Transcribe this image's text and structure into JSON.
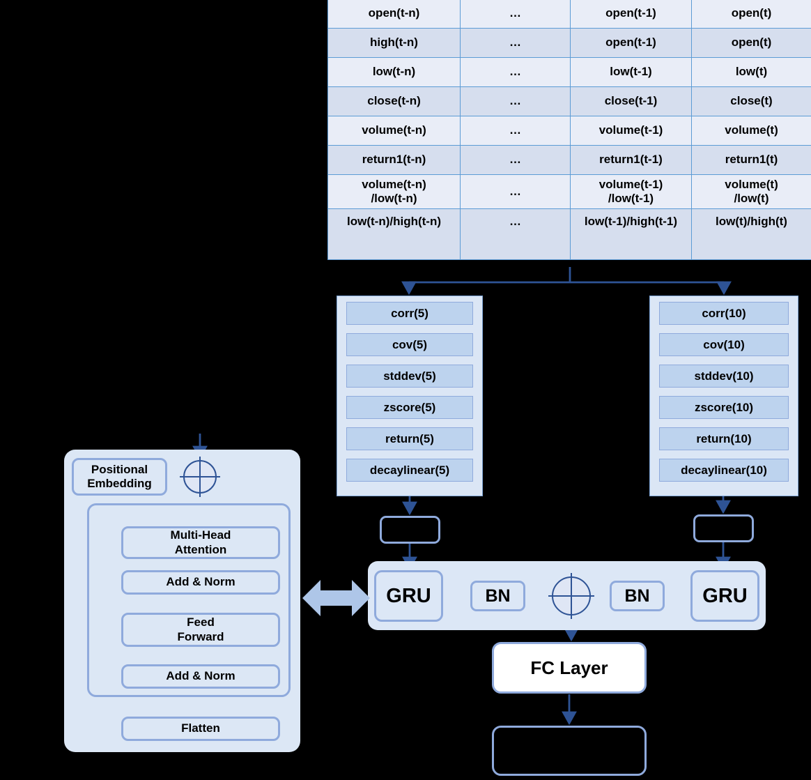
{
  "diagram": {
    "title": "Transformer-GRU factor model architecture",
    "colors": {
      "table_border": "#5b9bd5",
      "table_row_light": "#e9edf7",
      "table_row_dark": "#d6deee",
      "panel_fill": "#dce7f5",
      "box_fill": "#bdd3ee",
      "box_border": "#8faadc",
      "arrow": "#2e5395",
      "double_arrow": "#a9c4e8",
      "background": "#000000",
      "fc_fill": "#ffffff"
    }
  },
  "feature_table": {
    "columns": [
      "t-n",
      "...",
      "t-1",
      "t"
    ],
    "rows": [
      [
        "open(t-n)",
        "…",
        "open(t-1)",
        "open(t)"
      ],
      [
        "high(t-n)",
        "…",
        "open(t-1)",
        "open(t)"
      ],
      [
        "low(t-n)",
        "…",
        "low(t-1)",
        "low(t)"
      ],
      [
        "close(t-n)",
        "…",
        "close(t-1)",
        "close(t)"
      ],
      [
        "volume(t-n)",
        "…",
        "volume(t-1)",
        "volume(t)"
      ],
      [
        "return1(t-n)",
        "…",
        "return1(t-1)",
        "return1(t)"
      ],
      [
        "volume(t-n)\n/low(t-n)",
        "…",
        "volume(t-1)\n/low(t-1)",
        "volume(t)\n/low(t)"
      ],
      [
        "low(t-n)/high(t-n)",
        "…",
        "low(t-1)/high(t-1)",
        "low(t)/high(t)"
      ]
    ]
  },
  "operators": {
    "left_group": {
      "window": 5,
      "items": [
        "corr(5)",
        "cov(5)",
        "stddev(5)",
        "zscore(5)",
        "return(5)",
        "decaylinear(5)"
      ]
    },
    "right_group": {
      "window": 10,
      "items": [
        "corr(10)",
        "cov(10)",
        "stddev(10)",
        "zscore(10)",
        "return(10)",
        "decaylinear(10)"
      ]
    }
  },
  "intermediate_boxes": {
    "left_label": "",
    "right_label": ""
  },
  "recurrent_block": {
    "gru_left_label": "GRU",
    "bn_left_label": "BN",
    "add_symbol": "+",
    "bn_right_label": "BN",
    "gru_right_label": "GRU"
  },
  "output": {
    "fc_label": "FC Layer",
    "final_label": ""
  },
  "transformer": {
    "positional_embedding_label": "Positional\nEmbedding",
    "positional_embedding_line1": "Positional",
    "positional_embedding_line2": "Embedding",
    "add_symbol": "+",
    "multi_head_attention_line1": "Multi-Head",
    "multi_head_attention_line2": "Attention",
    "add_norm_1_label": "Add & Norm",
    "feed_forward_line1": "Feed",
    "feed_forward_line2": "Forward",
    "add_norm_2_label": "Add & Norm",
    "flatten_label": "Flatten"
  }
}
